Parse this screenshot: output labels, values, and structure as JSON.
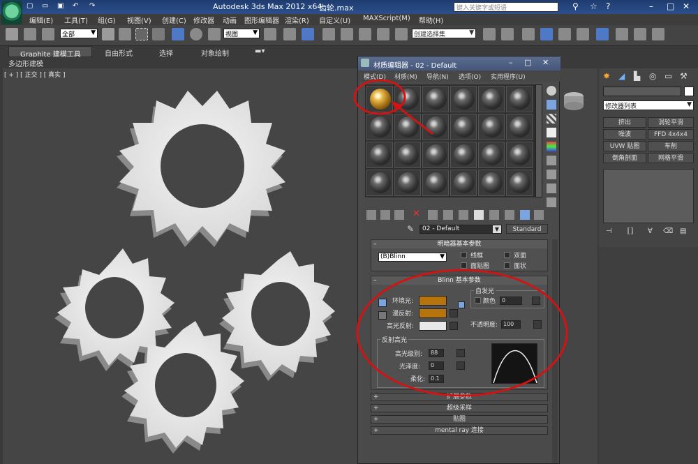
{
  "app": {
    "title": "Autodesk 3ds Max  2012 x64",
    "file": "齿轮.max",
    "search_placeholder": "键入关键字或短语"
  },
  "menu": [
    "编辑(E)",
    "工具(T)",
    "组(G)",
    "视图(V)",
    "创建(C)",
    "修改器",
    "动画",
    "图形编辑器",
    "渲染(R)",
    "自定义(U)",
    "MAXScript(M)",
    "帮助(H)"
  ],
  "toolbar": {
    "selection_filter": "全部",
    "ref_coord": "视图",
    "named_selection": "创建选择集"
  },
  "ribbon": {
    "tabs": [
      "Graphite 建模工具",
      "自由形式",
      "选择",
      "对象绘制"
    ],
    "sub": "多边形建模"
  },
  "viewport": {
    "label": "[ + ] [ 正交 ] [ 真实 ]"
  },
  "command_panel": {
    "modifier_list": "修改器列表",
    "buttons": [
      [
        "挤出",
        "涡轮平滑"
      ],
      [
        "噪波",
        "FFD 4x4x4"
      ],
      [
        "UVW 贴图",
        "车削"
      ],
      [
        "倒角剖面",
        "网格平滑"
      ]
    ]
  },
  "material_editor": {
    "title": "材质编辑器 - 02 - Default",
    "menu": [
      "模式(D)",
      "材质(M)",
      "导航(N)",
      "选项(O)",
      "实用程序(U)"
    ],
    "material_name": "02 - Default",
    "material_type": "Standard",
    "shader_rollout": {
      "title": "明暗器基本参数",
      "shader": "(B)Blinn",
      "options": [
        "线框",
        "双面",
        "面贴图",
        "面状"
      ]
    },
    "blinn_rollout": {
      "title": "Blinn 基本参数",
      "self_illum": "自发光",
      "color_label": "颜色",
      "color_value": "0",
      "ambient": "环境光:",
      "diffuse": "漫反射:",
      "specular": "高光反射:",
      "opacity_label": "不透明度:",
      "opacity_value": "100",
      "ambient_color": "#b8740c",
      "diffuse_color": "#b8740c",
      "specular_color": "#e8e8e8"
    },
    "highlights": {
      "title": "反射高光",
      "spec_level_label": "高光级别:",
      "spec_level": "88",
      "gloss_label": "光泽度:",
      "gloss": "0",
      "soften_label": "柔化:",
      "soften": "0.1"
    },
    "extra_rollouts": [
      "扩展参数",
      "超级采样",
      "贴图",
      "mental ray 连接"
    ]
  },
  "colors": {
    "annotation_red": "#d01414"
  }
}
